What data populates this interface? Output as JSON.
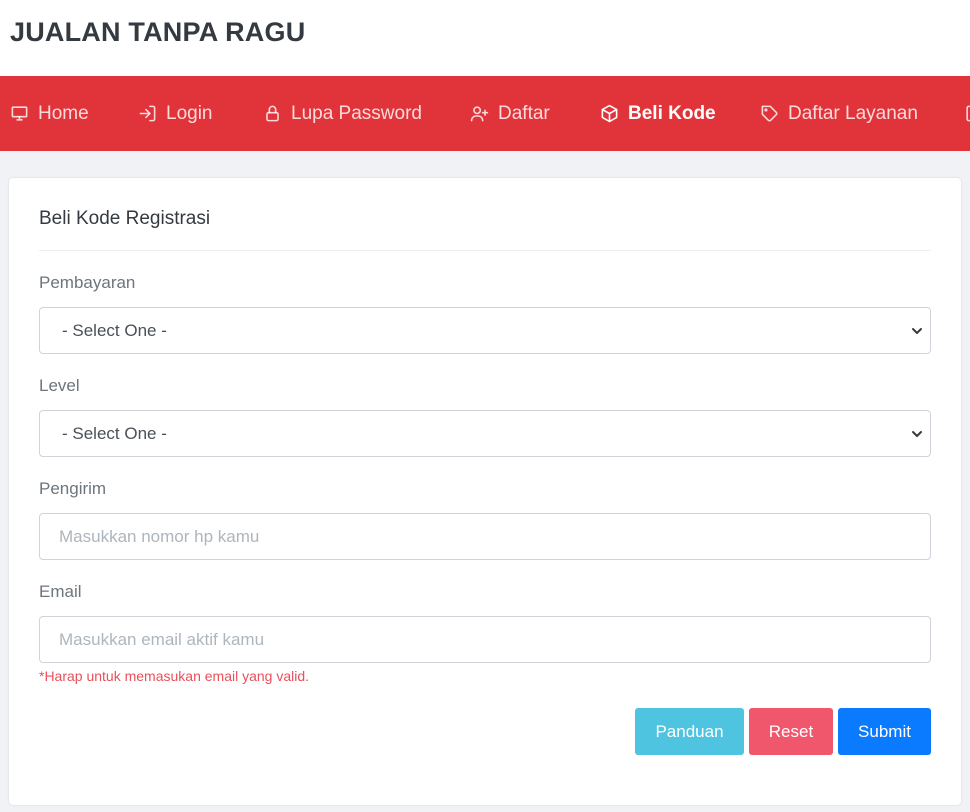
{
  "brand": {
    "title": "JUALAN TANPA RAGU"
  },
  "nav": {
    "items": [
      {
        "label": "Home",
        "icon": "monitor-icon"
      },
      {
        "label": "Login",
        "icon": "login-icon"
      },
      {
        "label": "Lupa Password",
        "icon": "lock-icon"
      },
      {
        "label": "Daftar",
        "icon": "user-plus-icon"
      },
      {
        "label": "Beli Kode",
        "icon": "package-icon",
        "active": true
      },
      {
        "label": "Daftar Layanan",
        "icon": "tag-icon"
      }
    ],
    "color": "#e0343a"
  },
  "form": {
    "title": "Beli Kode Registrasi",
    "pembayaran": {
      "label": "Pembayaran",
      "value": "- Select One -"
    },
    "level": {
      "label": "Level",
      "value": "- Select One -"
    },
    "pengirim": {
      "label": "Pengirim",
      "placeholder": "Masukkan nomor hp kamu"
    },
    "email": {
      "label": "Email",
      "placeholder": "Masukkan email aktif kamu",
      "hint": "*Harap untuk memasukan email yang valid."
    }
  },
  "buttons": {
    "panduan": "Panduan",
    "reset": "Reset",
    "submit": "Submit"
  }
}
